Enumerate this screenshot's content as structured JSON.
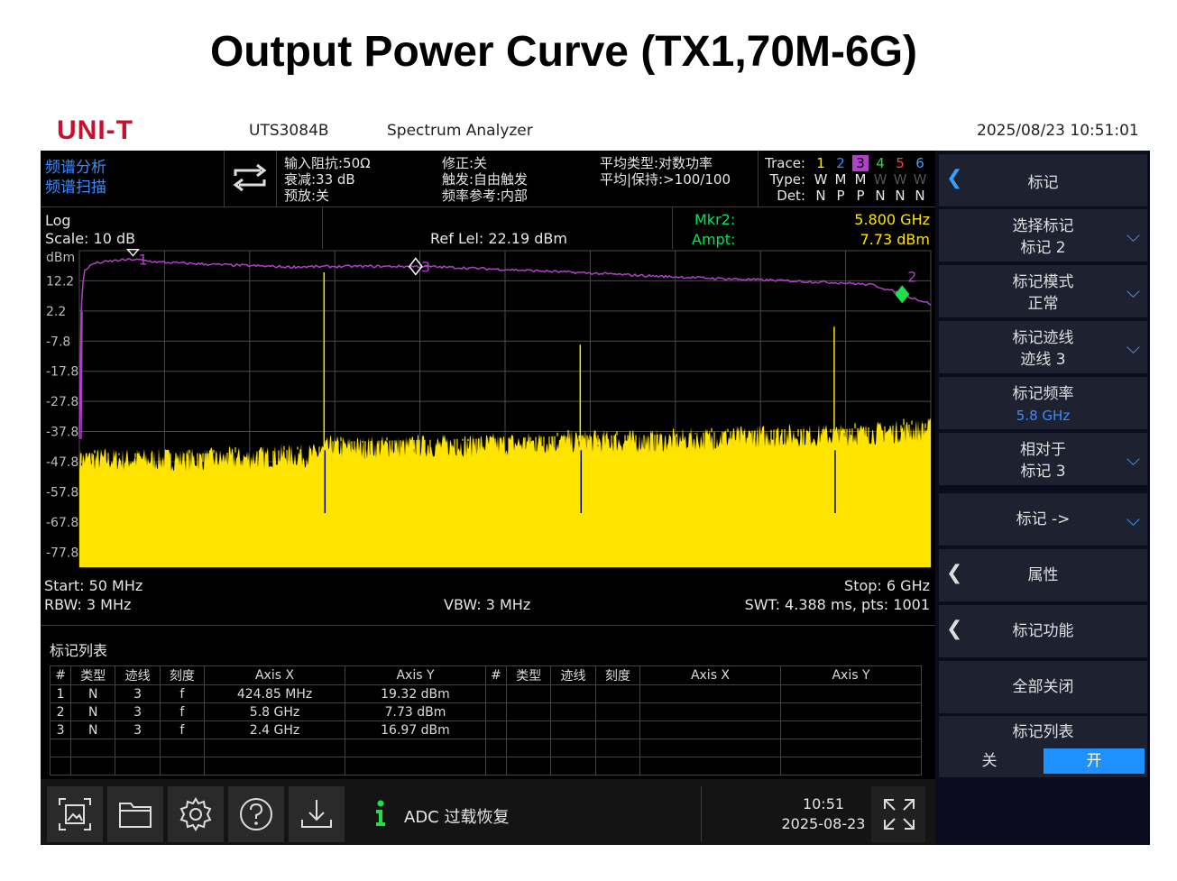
{
  "headline": "Output Power Curve (TX1,70M-6G)",
  "topbar": {
    "logo": "UNI-T",
    "model": "UTS3084B",
    "app_title": "Spectrum Analyzer",
    "datetime": "2025/08/23 10:51:01"
  },
  "status": {
    "mode_line1": "频谱分析",
    "mode_line2": "频谱扫描",
    "impedance": "输入阻抗:50Ω",
    "attenuation": "衰减:33 dB",
    "preamp": "预放:关",
    "correction": "修正:关",
    "trigger": "触发:自由触发",
    "freq_ref": "频率参考:内部",
    "avg_type": "平均类型:对数功率",
    "avg_hold": "平均|保持:>100/100",
    "trace_label": "Trace:",
    "type_label": "Type:",
    "det_label": "Det:",
    "trace_nums": [
      "1",
      "2",
      "3",
      "4",
      "5",
      "6"
    ],
    "trace_types": [
      "W",
      "M",
      "M",
      "W",
      "W",
      "W"
    ],
    "trace_dets": [
      "N",
      "P",
      "P",
      "N",
      "N",
      "N"
    ]
  },
  "plot": {
    "scale_type": "Log",
    "scale": "Scale: 10 dB",
    "ref_level": "Ref Lel: 22.19 dBm",
    "mkr_label": "Mkr2:",
    "mkr_freq": "5.800 GHz",
    "ampt_label": "Ampt:",
    "ampt_value": "7.73 dBm",
    "y_unit": "dBm",
    "y_ticks": [
      "12.2",
      "2.2",
      "-7.8",
      "-17.8",
      "-27.8",
      "-37.8",
      "-47.8",
      "-57.8",
      "-67.8",
      "-77.8"
    ],
    "start": "Start: 50 MHz",
    "stop": "Stop: 6 GHz",
    "rbw": "RBW: 3 MHz",
    "vbw": "VBW: 3 MHz",
    "swt": "SWT: 4.388 ms, pts: 1001",
    "marker_labels": [
      "1",
      "2",
      "3"
    ]
  },
  "chart_data": {
    "type": "line",
    "xlim_mhz": [
      50,
      6000
    ],
    "ylim_dbm": [
      -82.8,
      22.19
    ],
    "series": [
      {
        "name": "Trace 3",
        "color": "#b040c8",
        "x_mhz": [
          50,
          60,
          80,
          150,
          300,
          424.85,
          600,
          1000,
          1500,
          2000,
          2400,
          2500,
          3000,
          3500,
          4000,
          4500,
          5000,
          5400,
          5600,
          5800,
          6000
        ],
        "y_dbm": [
          -40,
          0,
          15.5,
          18.0,
          18.9,
          19.32,
          18.4,
          17.6,
          16.8,
          17.0,
          16.97,
          16.9,
          16.0,
          15.0,
          13.9,
          13.0,
          12.2,
          11.5,
          10.8,
          7.73,
          4.5
        ]
      },
      {
        "name": "Trace 1",
        "color": "#ffe400",
        "x_mhz": [
          50,
          1000,
          1700,
          1800,
          2000,
          3000,
          3600,
          4000,
          5000,
          5400,
          6000
        ],
        "y_dbm": [
          -48,
          -48,
          -46.5,
          -44,
          -44,
          -43,
          -42,
          -42,
          -40,
          -40,
          -38
        ]
      }
    ],
    "spurs": [
      {
        "x_mhz": 1760,
        "peak_dbm": 15
      },
      {
        "x_mhz": 3550,
        "peak_dbm": -9
      },
      {
        "x_mhz": 5325,
        "peak_dbm": -3
      }
    ],
    "markers": [
      {
        "label": "1",
        "x_mhz": 424.85,
        "y_dbm": 19.32
      },
      {
        "label": "2",
        "x_mhz": 5800,
        "y_dbm": 7.73
      },
      {
        "label": "3",
        "x_mhz": 2400,
        "y_dbm": 16.97
      }
    ]
  },
  "marker_table": {
    "title": "标记列表",
    "headers": [
      "#",
      "类型",
      "迹线",
      "刻度",
      "Axis X",
      "Axis Y",
      "#",
      "类型",
      "迹线",
      "刻度",
      "Axis X",
      "Axis Y"
    ],
    "rows": [
      [
        "1",
        "N",
        "3",
        "f",
        "424.85 MHz",
        "19.32 dBm"
      ],
      [
        "2",
        "N",
        "3",
        "f",
        "5.8 GHz",
        "7.73 dBm"
      ],
      [
        "3",
        "N",
        "3",
        "f",
        "2.4 GHz",
        "16.97 dBm"
      ]
    ]
  },
  "bottombar": {
    "message": "ADC 过载恢复",
    "time": "10:51",
    "date": "2025-08-23"
  },
  "sidebar": {
    "header": "标记",
    "items": [
      {
        "line1": "选择标记",
        "line2": "标记 2"
      },
      {
        "line1": "标记模式",
        "line2": "正常"
      },
      {
        "line1": "标记迹线",
        "line2": "迹线 3"
      },
      {
        "line1": "标记频率",
        "line2": "5.8 GHz"
      },
      {
        "line1": "相对于",
        "line2": "标记 3"
      },
      {
        "line1": "标记 ->",
        "line2": ""
      },
      {
        "line1": "属性",
        "line2": ""
      },
      {
        "line1": "标记功能",
        "line2": ""
      },
      {
        "line1": "全部关闭",
        "line2": ""
      },
      {
        "line1": "标记列表",
        "line2": ""
      }
    ],
    "toggle_off": "关",
    "toggle_on": "开"
  }
}
